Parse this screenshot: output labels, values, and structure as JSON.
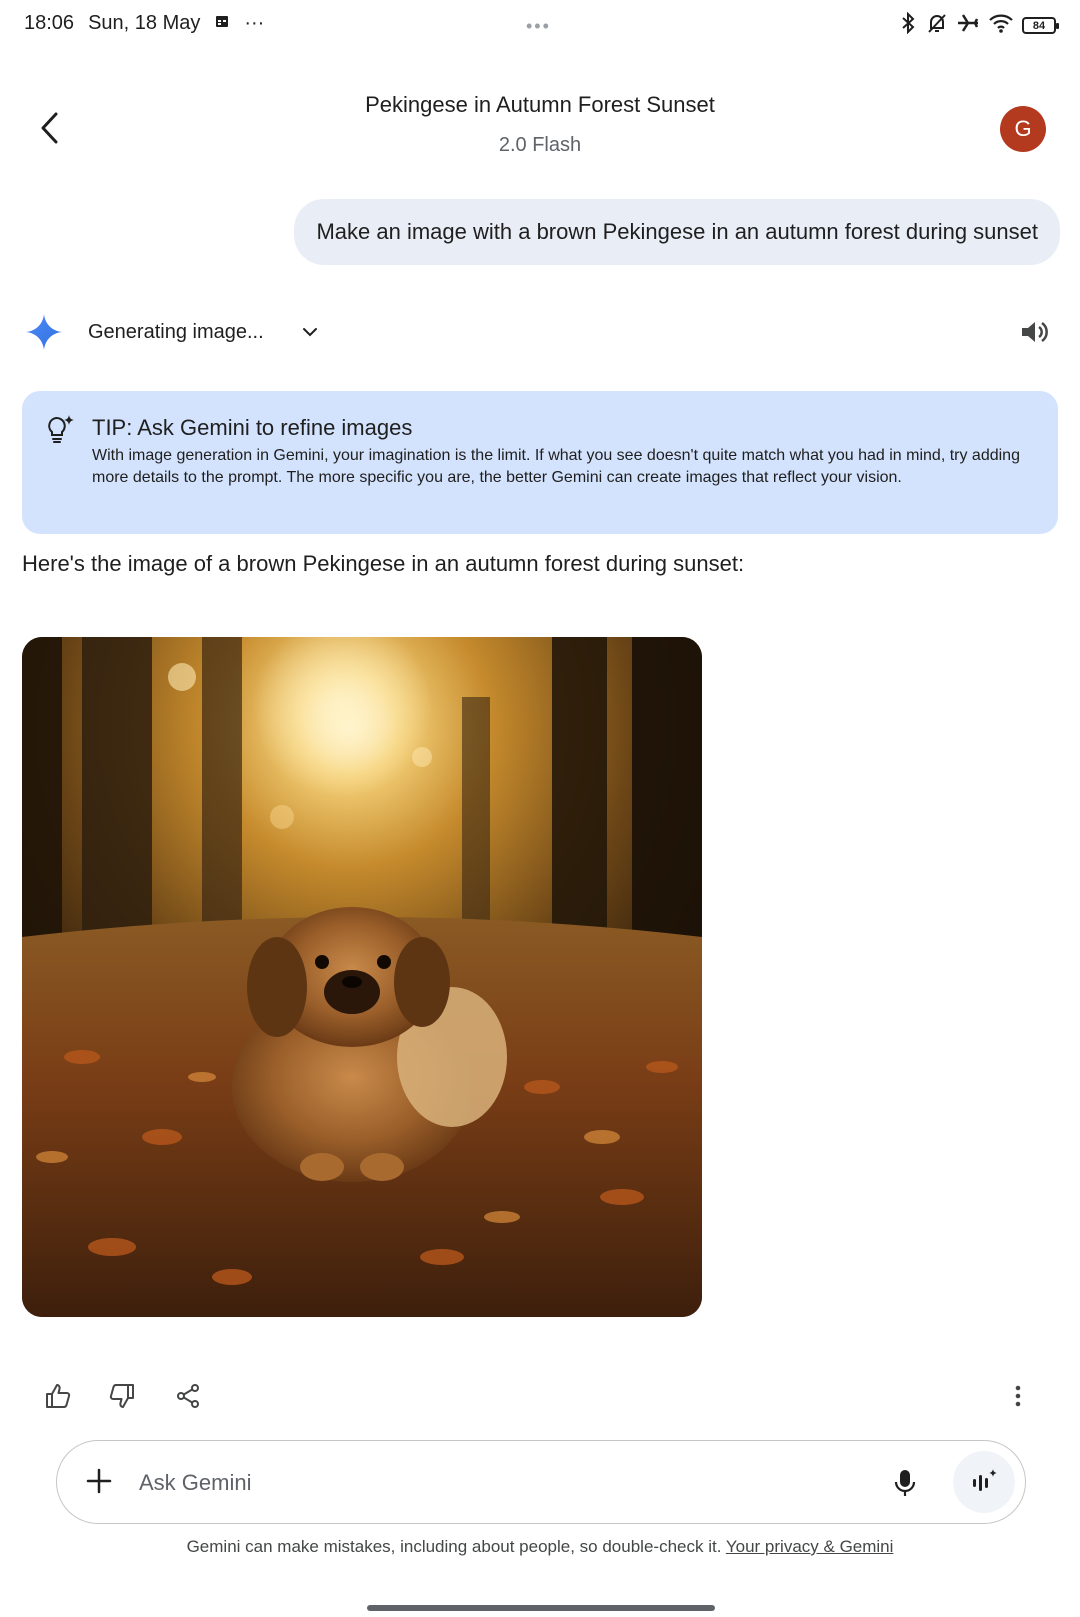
{
  "status_bar": {
    "time": "18:06",
    "date": "Sun, 18 May",
    "overflow": "···",
    "battery": "84",
    "icons": [
      "calendar-icon",
      "bluetooth-icon",
      "bell-off-icon",
      "airplane-icon",
      "wifi-icon",
      "battery-icon"
    ]
  },
  "header": {
    "title": "Pekingese in Autumn Forest Sunset",
    "model": "2.0 Flash",
    "avatar_letter": "G"
  },
  "conversation": {
    "user_prompt": "Make an image with a brown Pekingese in an autumn forest during sunset",
    "status_label": "Generating image...",
    "tip": {
      "title": "TIP: Ask Gemini to refine images",
      "body": "With image generation in Gemini, your imagination is the limit. If what you see doesn't quite match what you had in mind, try adding more details to the prompt. The more specific you are, the better Gemini can create images that reflect your vision."
    },
    "response_text": "Here's the image of a brown Pekingese in an autumn forest during sunset:"
  },
  "input": {
    "placeholder": "Ask Gemini"
  },
  "footer": {
    "disclaimer": "Gemini can make mistakes, including about people, so double-check it.",
    "privacy_link": "Your privacy & Gemini"
  },
  "colors": {
    "avatar": "#b3391f",
    "tip_background": "#d3e3fd",
    "user_bubble": "#e9eef6",
    "gemini_blue": "#4285f4"
  }
}
